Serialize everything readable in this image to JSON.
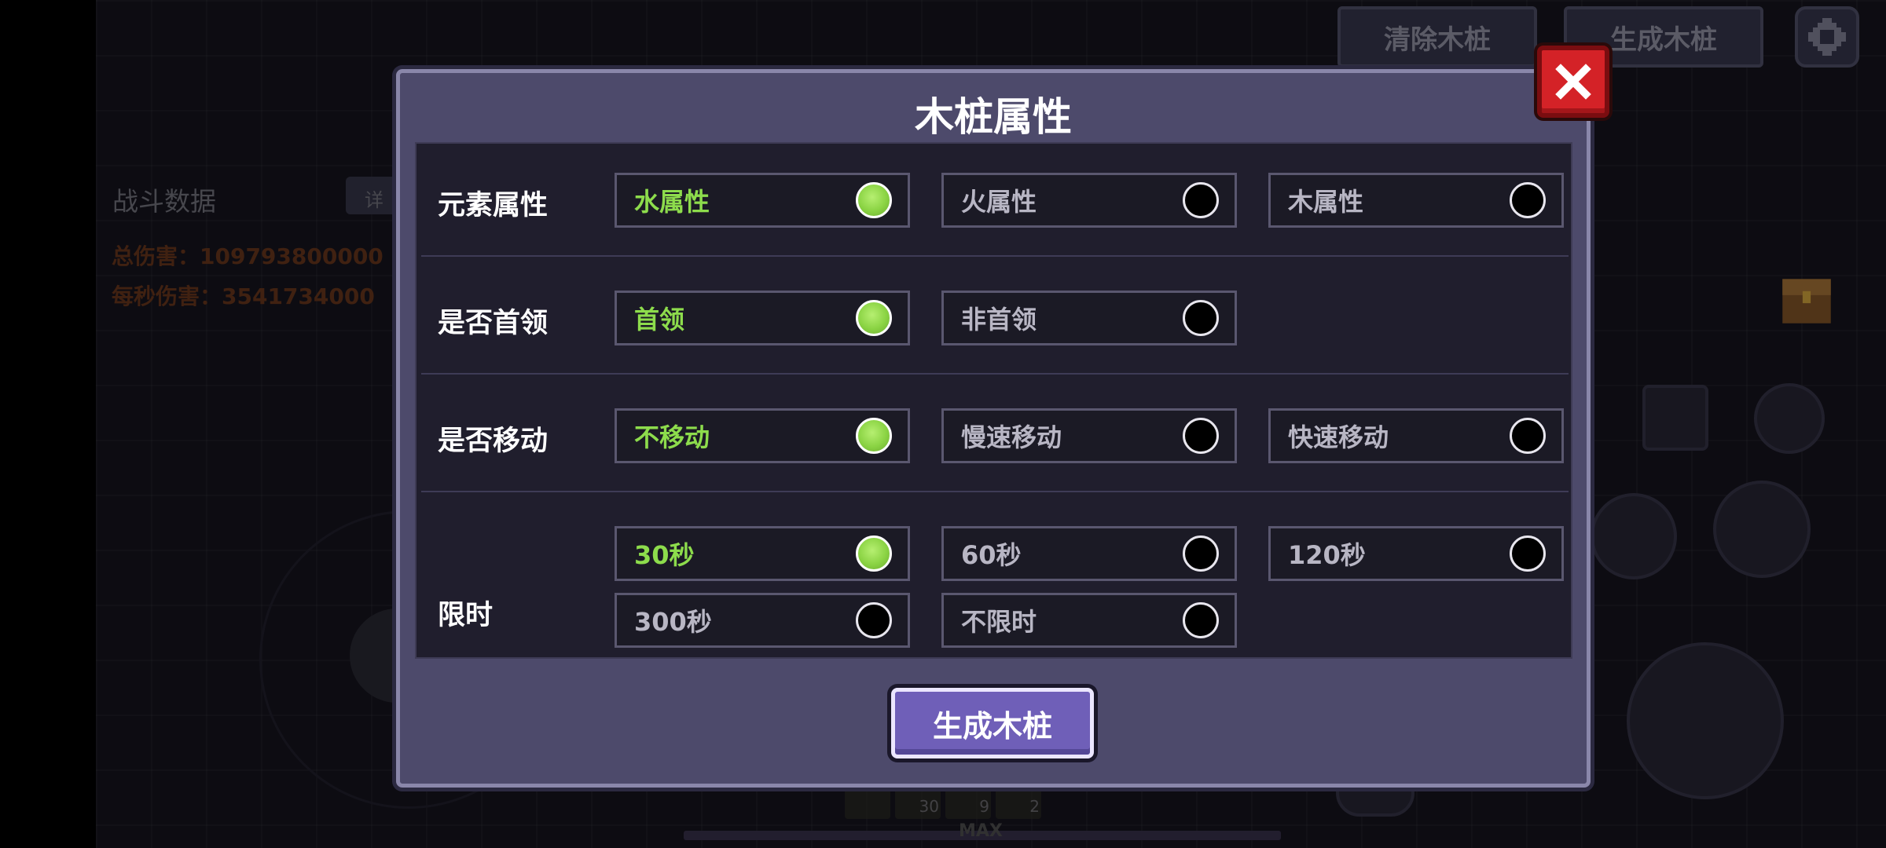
{
  "top_buttons": {
    "clear_stakes": "清除木桩",
    "spawn_stakes": "生成木桩"
  },
  "icons": {
    "settings": "gear-icon",
    "close": "close-x-icon",
    "chest": "treasure-chest-icon"
  },
  "combat": {
    "title": "战斗数据",
    "detail_button": "详",
    "total_damage": "总伤害：109793800000",
    "dps": "每秒伤害：3541734000"
  },
  "hotbar": {
    "slots": [
      "",
      "30",
      "9",
      "2"
    ],
    "max_label": "MAX"
  },
  "modal": {
    "title": "木桩属性",
    "rows": [
      {
        "label": "元素属性",
        "options": [
          {
            "label": "水属性",
            "selected": true
          },
          {
            "label": "火属性",
            "selected": false
          },
          {
            "label": "木属性",
            "selected": false
          }
        ]
      },
      {
        "label": "是否首领",
        "options": [
          {
            "label": "首领",
            "selected": true
          },
          {
            "label": "非首领",
            "selected": false
          }
        ]
      },
      {
        "label": "是否移动",
        "options": [
          {
            "label": "不移动",
            "selected": true
          },
          {
            "label": "慢速移动",
            "selected": false
          },
          {
            "label": "快速移动",
            "selected": false
          }
        ]
      },
      {
        "label": "限时",
        "options": [
          {
            "label": "30秒",
            "selected": true
          },
          {
            "label": "60秒",
            "selected": false
          },
          {
            "label": "120秒",
            "selected": false
          },
          {
            "label": "300秒",
            "selected": false
          },
          {
            "label": "不限时",
            "selected": false
          }
        ]
      }
    ],
    "generate_button": "生成木桩"
  },
  "colors": {
    "selected_text": "#8ddc4c",
    "button_purple": "#6f5fb8",
    "close_red": "#d42227"
  }
}
